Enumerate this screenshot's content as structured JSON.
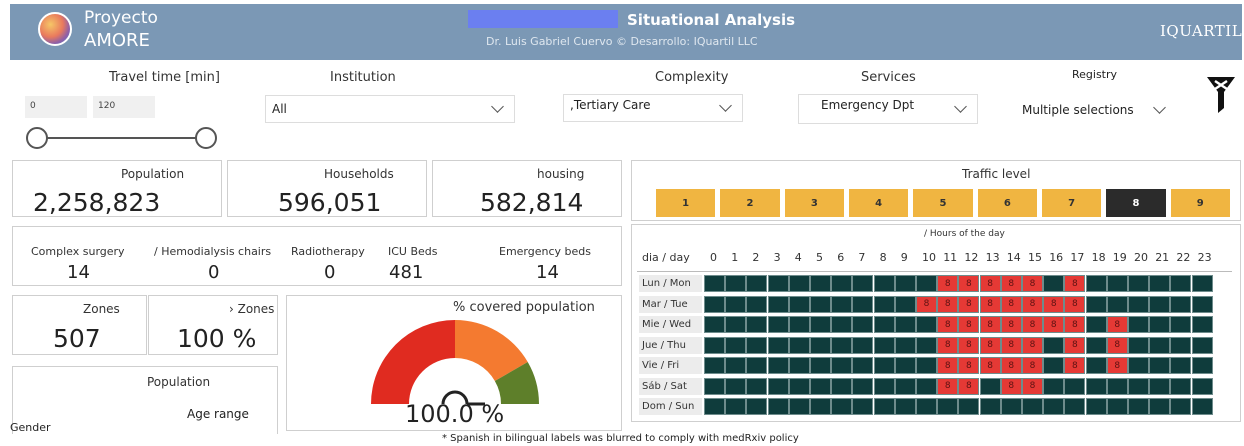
{
  "header": {
    "app_name_line1": "Proyecto",
    "app_name_line2": "AMORE",
    "title": "Situational Analysis",
    "subtitle": "Dr. Luis Gabriel Cuervo © Desarrollo: IQuartil LLC",
    "brand": "IQUARTIL"
  },
  "filters": {
    "travel_time": {
      "label": "Travel time [min]",
      "min_value": "0",
      "max_value": "120"
    },
    "institution": {
      "label": "Institution",
      "value": "All"
    },
    "complexity": {
      "label": "Complexity",
      "value": ",Tertiary Care"
    },
    "services": {
      "label": "Services",
      "value": "Emergency Dpt"
    },
    "registry": {
      "label": "Registry",
      "value": "Multiple selections"
    }
  },
  "kpis": {
    "population": {
      "label": "Population",
      "value": "2,258,823"
    },
    "households": {
      "label": "Households",
      "value": "596,051"
    },
    "housing": {
      "label": "housing",
      "value": "582,814"
    }
  },
  "resources": [
    {
      "label": "Complex surgery",
      "value": "14"
    },
    {
      "label": "/ Hemodialysis chairs",
      "value": "0"
    },
    {
      "label": "Radiotherapy",
      "value": "0"
    },
    {
      "label": "ICU Beds",
      "value": "481"
    },
    {
      "label": "Emergency beds",
      "value": "14"
    }
  ],
  "zones": {
    "label": "Zones",
    "value": "507",
    "pct_label": "› Zones",
    "pct_value": "100 %"
  },
  "population_panel": {
    "title": "Population",
    "gender_label": "Gender",
    "age_label": "Age range"
  },
  "gauge": {
    "title": "% covered population",
    "value": "100.0 %",
    "fraction": 1.0,
    "colors": [
      "#e02b20",
      "#f47a30",
      "#5e7f2a"
    ]
  },
  "traffic": {
    "title": "Traffic level",
    "levels": [
      "1",
      "2",
      "3",
      "4",
      "5",
      "6",
      "7",
      "8",
      "9"
    ],
    "selected": "8",
    "grid_title": "/ Hours of the day",
    "row_header": "dia / day",
    "hours": [
      "0",
      "1",
      "2",
      "3",
      "4",
      "5",
      "6",
      "7",
      "8",
      "9",
      "10",
      "11",
      "12",
      "13",
      "14",
      "15",
      "16",
      "17",
      "18",
      "19",
      "20",
      "21",
      "22",
      "23"
    ],
    "days": [
      "Lun / Mon",
      "Mar / Tue",
      "Mie / Wed",
      "Jue / Thu",
      "Vie / Fri",
      "Sáb / Sat",
      "Dom / Sun"
    ],
    "marked_value": "8",
    "marked_cells": [
      [
        11,
        12,
        13,
        14,
        15,
        17
      ],
      [
        10,
        11,
        12,
        13,
        14,
        15,
        16,
        17
      ],
      [
        11,
        12,
        13,
        14,
        15,
        16,
        17,
        19
      ],
      [
        11,
        12,
        13,
        14,
        15,
        17,
        19
      ],
      [
        11,
        12,
        13,
        14,
        15,
        17,
        19
      ],
      [
        11,
        12,
        14,
        15
      ],
      []
    ]
  },
  "footnote": "* Spanish in bilingual labels was blurred to comply with medRxiv policy"
}
